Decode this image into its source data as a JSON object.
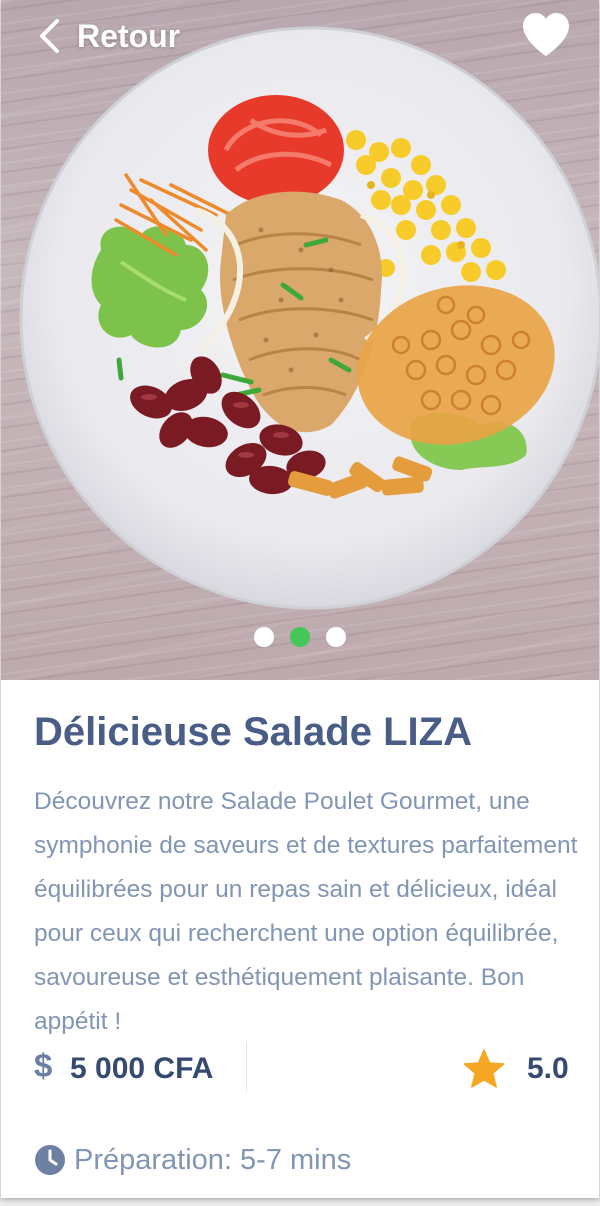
{
  "header": {
    "back_label": "Retour",
    "back_icon": "chevron-left-icon",
    "favorite_icon": "heart-icon"
  },
  "carousel": {
    "count": 3,
    "active_index": 1,
    "active_color": "#45c659"
  },
  "dish": {
    "title": "Délicieuse Salade LIZA",
    "description": "Découvrez notre Salade Poulet Gourmet, une symphonie de saveurs et de textures parfaitement équilibrées pour un repas sain et délicieux, idéal pour ceux qui recherchent une option équilibrée, savoureuse et esthétiquement plaisante. Bon appétit !",
    "currency_symbol": "$",
    "price": "5 000 CFA",
    "rating": "5.0",
    "rating_icon": "star-icon",
    "preparation": "Préparation: 5-7 mins",
    "preparation_icon": "clock-icon"
  },
  "colors": {
    "title": "#495d86",
    "text": "#8195b5",
    "star": "#f5a623"
  }
}
